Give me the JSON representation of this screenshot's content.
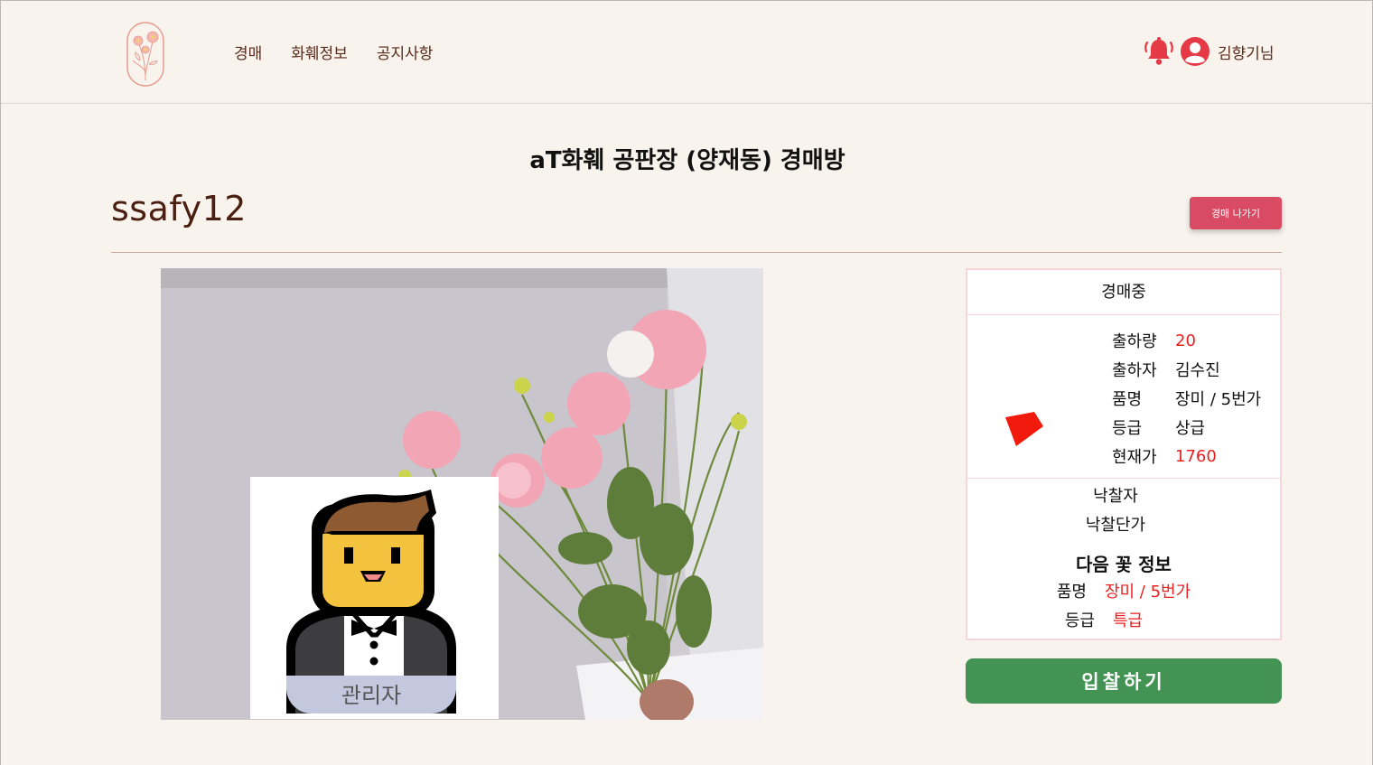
{
  "nav": {
    "items": [
      "경매",
      "화훼정보",
      "공지사항"
    ]
  },
  "user": {
    "display_name": "김향기님"
  },
  "room": {
    "title": "aT화훼 공판장 (양재동) 경매방",
    "participant": "ssafy12",
    "exit_label": "경매 나가기"
  },
  "video": {
    "admin_label": "관리자"
  },
  "auction": {
    "status": "경매중",
    "details": [
      {
        "label": "출하량",
        "value": "20",
        "highlight": true
      },
      {
        "label": "출하자",
        "value": "김수진",
        "highlight": false
      },
      {
        "label": "품명",
        "value": "장미 / 5번가",
        "highlight": false
      },
      {
        "label": "등급",
        "value": "상급",
        "highlight": false
      },
      {
        "label": "현재가",
        "value": "1760",
        "highlight": true
      }
    ],
    "winner_label": "낙찰자",
    "winning_price_label": "낙찰단가",
    "next_title": "다음 꽃 정보",
    "next": {
      "item_label": "품명",
      "item_value": "장미 / 5번가",
      "grade_label": "등급",
      "grade_value": "특급"
    },
    "bid_label": "입찰하기"
  },
  "colors": {
    "background": "#f8f3ec",
    "accent_red": "#e82020",
    "exit_button": "#d94a63",
    "bid_button": "#439354",
    "brand_brown": "#4a1e10"
  }
}
